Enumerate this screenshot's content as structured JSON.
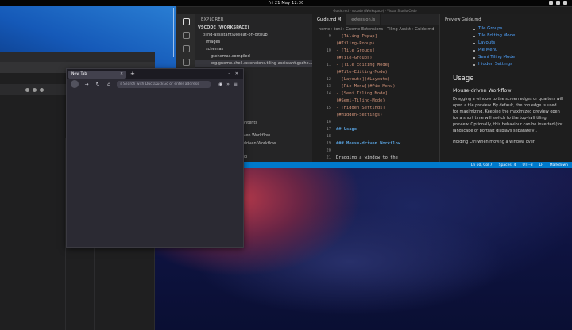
{
  "topbar": {
    "clock": "Fri 21 May  12:30"
  },
  "vscode": {
    "title": "Guide.md - vscode (Workspace) - Visual Studio Code",
    "explorer_header": "EXPLORER",
    "workspace": "VSCODE (WORKSPACE)",
    "tree": [
      {
        "label": "tiling-assistant@leleat-on-github",
        "level": 0
      },
      {
        "label": "images",
        "level": 1
      },
      {
        "label": "schemas",
        "level": 1
      },
      {
        "label": "gschemas.compiled",
        "level": 2
      },
      {
        "label": "org.gnome.shell.extensions.tiling-assistant.gsche...",
        "level": 2
      }
    ],
    "outline_partial": [
      "ontents",
      "iven Workflow",
      "-driven Workflow",
      "op"
    ],
    "tabs": [
      {
        "label": "Guide.md  M",
        "active": true
      },
      {
        "label": "extension.js",
        "active": false
      }
    ],
    "breadcrumb": "home › toni › Gnome-Extensions › Tiling-Assist › Guide.md",
    "code": [
      {
        "n": "9",
        "t": "- [Tiling Popup]",
        "k": "s"
      },
      {
        "n": "",
        "t": "(#Tiling-Popup)",
        "k": "s"
      },
      {
        "n": "10",
        "t": "- [Tile Groups]",
        "k": "s"
      },
      {
        "n": "",
        "t": "(#Tile-Groups)",
        "k": "s"
      },
      {
        "n": "11",
        "t": "- [Tile Editing Mode]",
        "k": "s"
      },
      {
        "n": "",
        "t": "(#Tile-Editing-Mode)",
        "k": "s"
      },
      {
        "n": "12",
        "t": "- [Layouts](#Layouts)",
        "k": "s"
      },
      {
        "n": "13",
        "t": "- [Pie Menu](#Pie-Menu)",
        "k": "s"
      },
      {
        "n": "14",
        "t": "- [Semi Tiling Mode]",
        "k": "s"
      },
      {
        "n": "",
        "t": "(#Semi-Tiling-Mode)",
        "k": "s"
      },
      {
        "n": "15",
        "t": "- [Hidden Settings]",
        "k": "s"
      },
      {
        "n": "",
        "t": "(#Hidden-Settings)",
        "k": "s"
      },
      {
        "n": "16",
        "t": "",
        "k": "p"
      },
      {
        "n": "17",
        "t": "## Usage",
        "k": "h"
      },
      {
        "n": "18",
        "t": "",
        "k": "p"
      },
      {
        "n": "19",
        "t": "### Mouse-driven Workflow",
        "k": "h"
      },
      {
        "n": "20",
        "t": "",
        "k": "p"
      },
      {
        "n": "21",
        "t": "Dragging a window to the",
        "k": "p"
      },
      {
        "n": "",
        "t": "screen edges or quarters will",
        "k": "p"
      },
      {
        "n": "",
        "t": "open a tile preview. By",
        "k": "p"
      }
    ],
    "preview": {
      "tab": "Preview Guide.md",
      "links": [
        "Tile Groups",
        "Tile Editing Mode",
        "Layouts",
        "Pie Menu",
        "Semi Tiling Mode",
        "Hidden Settings"
      ],
      "h2": "Usage",
      "h3": "Mouse-driven Workflow",
      "paragraph": "Dragging a window to the screen edges or quarters will open a tile preview. By default, the top edge is used for maximizing. Keeping the maximized preview open for a short time will switch to the top-half tiling preview. Optionally, this behaviour can be inverted (for landscape or portrait displays separately).",
      "paragraph2": "Holding Ctrl when moving a window over"
    },
    "status": [
      "Ln 60, Col 7",
      "Spaces: 4",
      "UTF-8",
      "LF",
      "Markdown"
    ]
  },
  "firefox": {
    "tab": "New Tab",
    "url_placeholder": "Search with DuckDuckGo or enter address"
  }
}
